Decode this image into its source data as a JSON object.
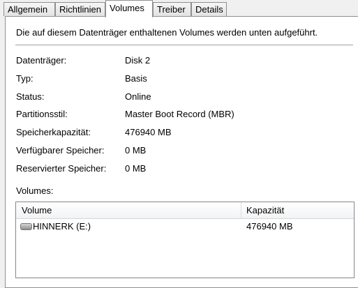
{
  "tabs": [
    {
      "label": "Allgemein"
    },
    {
      "label": "Richtlinien"
    },
    {
      "label": "Volumes"
    },
    {
      "label": "Treiber"
    },
    {
      "label": "Details"
    }
  ],
  "active_tab": "Volumes",
  "intro_text": "Die auf diesem Datenträger enthaltenen Volumes werden unten aufgeführt.",
  "properties": [
    {
      "label": "Datenträger:",
      "value": "Disk 2"
    },
    {
      "label": "Typ:",
      "value": "Basis"
    },
    {
      "label": "Status:",
      "value": "Online"
    },
    {
      "label": "Partitionsstil:",
      "value": "Master Boot Record (MBR)"
    },
    {
      "label": "Speicherkapazität:",
      "value": "476940 MB"
    },
    {
      "label": "Verfügbarer Speicher:",
      "value": "0 MB"
    },
    {
      "label": "Reservierter Speicher:",
      "value": "0 MB"
    }
  ],
  "volumes_label": "Volumes:",
  "volumes_table": {
    "columns": [
      "Volume",
      "Kapazität"
    ],
    "rows": [
      {
        "volume": "HINNERK (E:)",
        "capacity": "476940 MB",
        "icon": "drive-icon"
      }
    ]
  }
}
